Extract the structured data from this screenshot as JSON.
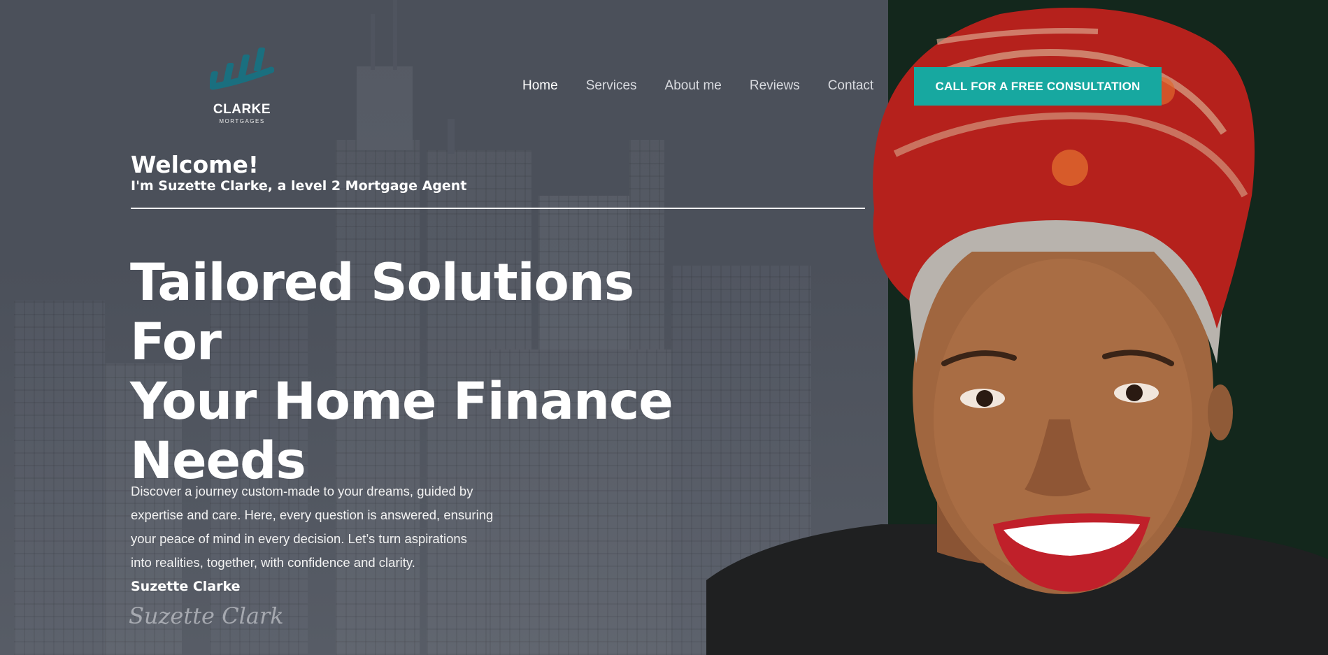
{
  "brand": {
    "name": "CLARKE",
    "sub": "MORTGAGES",
    "accent": "#17a8a0",
    "logo_color": "#1a6f7f"
  },
  "nav": {
    "items": [
      {
        "label": "Home",
        "active": true
      },
      {
        "label": "Services"
      },
      {
        "label": "About me"
      },
      {
        "label": "Reviews"
      },
      {
        "label": "Contact"
      }
    ],
    "cta_label": "CALL FOR A FREE CONSULTATION"
  },
  "hero": {
    "welcome": "Welcome!",
    "intro": "I'm Suzette Clarke, a level 2 Mortgage Agent",
    "headline_lines": [
      "Tailored Solutions For",
      "Your Home Finance",
      "Needs"
    ],
    "paragraph_lines": [
      "Discover a journey custom-made to your dreams, guided by",
      "expertise and care. Here, every question is answered, ensuring",
      "your peace of mind in every decision. Let’s turn aspirations",
      "into realities, together, with confidence and clarity."
    ],
    "signer": "Suzette Clarke",
    "signature": "Suzette Clark"
  },
  "colors": {
    "bg_left": "#4b505a",
    "bg_right": "#13271c",
    "scarf": "#b5211c",
    "lips": "#c0202a"
  }
}
